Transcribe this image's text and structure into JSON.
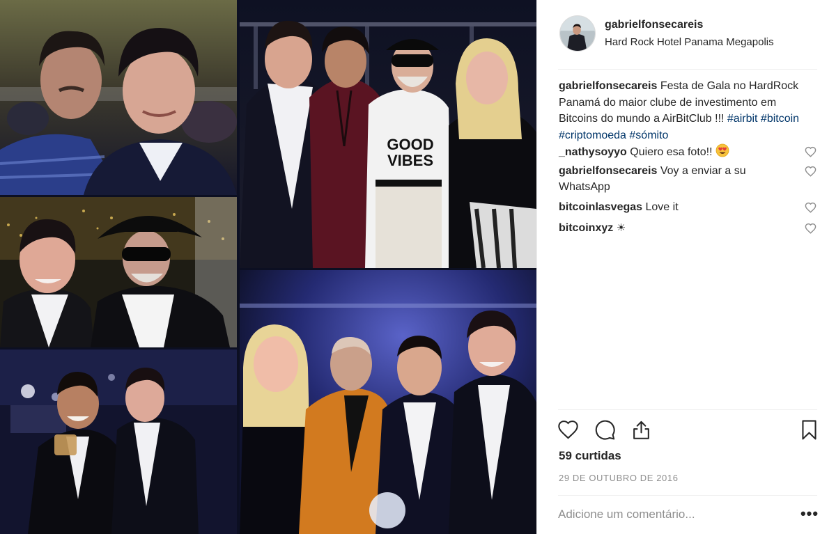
{
  "post": {
    "username": "gabrielfonsecareis",
    "location": "Hard Rock Hotel Panama Megapolis",
    "caption": {
      "username": "gabrielfonsecareis",
      "text": "Festa de Gala no HardRock Panamá do maior clube de investimento em Bitcoins do mundo a AirBitClub !!!",
      "hashtags": "#airbit #bitcoin #criptomoeda #sómito"
    },
    "comments": [
      {
        "username": "_nathysoyyo",
        "text": "Quiero esa foto!!",
        "emoji": "heart-eyes-emoji"
      },
      {
        "username": "gabrielfonsecareis",
        "text": "Voy a enviar a su WhatsApp"
      },
      {
        "username": "bitcoinlasvegas",
        "text": "Love it"
      },
      {
        "username": "bitcoinxyz",
        "text": "☀"
      }
    ],
    "likes": "59 curtidas",
    "date": "29 DE OUTUBRO DE 2016",
    "add_comment_placeholder": "Adicione um comentário...",
    "more_label": "•••"
  },
  "icons": {
    "like": "heart-icon",
    "comment": "comment-icon",
    "share": "share-icon",
    "save": "bookmark-icon",
    "comment_like": "heart-icon"
  },
  "colors": {
    "text": "#262626",
    "hashtag": "#003569",
    "secondary": "#8e8e8e",
    "divider": "#efefef"
  }
}
